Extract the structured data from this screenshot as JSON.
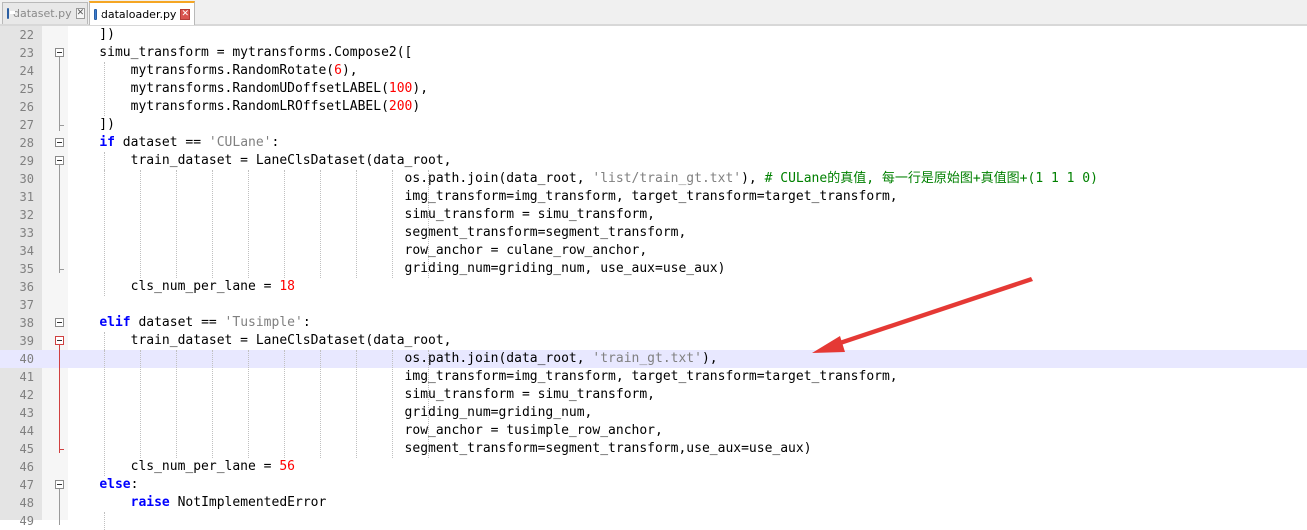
{
  "tabs": [
    {
      "label": "dataset.py",
      "active": false
    },
    {
      "label": "dataloader.py",
      "active": true
    }
  ],
  "editor": {
    "current_line": 40,
    "lines": [
      {
        "n": "22",
        "html": "    ])"
      },
      {
        "n": "23",
        "html": "    simu_transform = mytransforms.Compose2(["
      },
      {
        "n": "24",
        "html": "        mytransforms.RandomRotate(<span class='num'>6</span>),"
      },
      {
        "n": "25",
        "html": "        mytransforms.RandomUDoffsetLABEL(<span class='num'>100</span>),"
      },
      {
        "n": "26",
        "html": "        mytransforms.RandomLROffsetLABEL(<span class='num'>200</span>)"
      },
      {
        "n": "27",
        "html": "    ])"
      },
      {
        "n": "28",
        "html": "    <span class='kw'>if</span> dataset == <span class='str'>'CULane'</span>:"
      },
      {
        "n": "29",
        "html": "        train_dataset = LaneClsDataset(data_root,"
      },
      {
        "n": "30",
        "html": "                                           os.path.join(data_root, <span class='str'>'list/train_gt.txt'</span>), <span class='com'># CULane的真值, 每一行是原始图+真值图+(1 1 1 0)</span>"
      },
      {
        "n": "31",
        "html": "                                           img_transform=img_transform, target_transform=target_transform,"
      },
      {
        "n": "32",
        "html": "                                           simu_transform = simu_transform,"
      },
      {
        "n": "33",
        "html": "                                           segment_transform=segment_transform,"
      },
      {
        "n": "34",
        "html": "                                           row_anchor = culane_row_anchor,"
      },
      {
        "n": "35",
        "html": "                                           griding_num=griding_num, use_aux=use_aux)"
      },
      {
        "n": "36",
        "html": "        cls_num_per_lane = <span class='num'>18</span>"
      },
      {
        "n": "37",
        "html": ""
      },
      {
        "n": "38",
        "html": "    <span class='kw'>elif</span> dataset == <span class='str'>'Tusimple'</span>:"
      },
      {
        "n": "39",
        "html": "        train_dataset = LaneClsDataset(data_root,"
      },
      {
        "n": "40",
        "html": "                                           os.path.join(data_root, <span class='str'>'train_gt.txt'</span>),"
      },
      {
        "n": "41",
        "html": "                                           img_transform=img_transform, target_transform=target_transform,"
      },
      {
        "n": "42",
        "html": "                                           simu_transform = simu_transform,"
      },
      {
        "n": "43",
        "html": "                                           griding_num=griding_num,"
      },
      {
        "n": "44",
        "html": "                                           row_anchor = tusimple_row_anchor,"
      },
      {
        "n": "45",
        "html": "                                           segment_transform=segment_transform,use_aux=use_aux)"
      },
      {
        "n": "46",
        "html": "        cls_num_per_lane = <span class='num'>56</span>"
      },
      {
        "n": "47",
        "html": "    <span class='kw'>else</span>:"
      },
      {
        "n": "48",
        "html": "        <span class='kw'>raise</span> NotImplementedError"
      },
      {
        "n": "49",
        "html": ""
      }
    ]
  },
  "colors": {
    "keyword": "#0000ff",
    "string": "#808080",
    "number": "#ff0000",
    "comment": "#008000",
    "arrow": "#e53935",
    "current_line_bg": "#e8e8ff"
  },
  "icons": {
    "tab_file_icon": "python-file-icon",
    "tab_close_icon": "close-icon",
    "fold_marker": "fold-minus-icon",
    "annotation": "red-arrow"
  }
}
